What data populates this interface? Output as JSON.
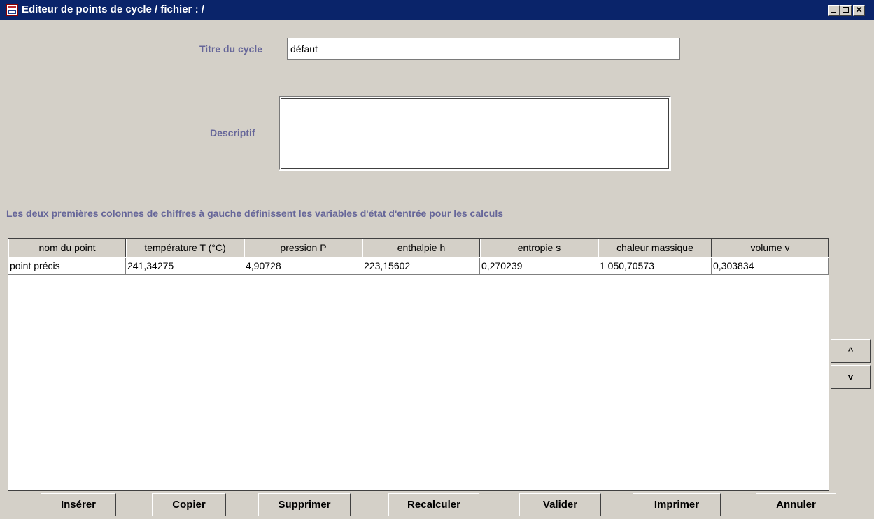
{
  "window": {
    "title": "Editeur de points de cycle / fichier :  /",
    "app_icon": "java-cup-icon"
  },
  "form": {
    "title_label": "Titre du cycle",
    "title_value": "défaut",
    "desc_label": "Descriptif",
    "desc_value": "",
    "info_text": "Les deux premières colonnes de chiffres à gauche définissent les variables d'état d'entrée pour les calculs"
  },
  "table": {
    "columns": [
      "nom du point",
      "température  T (°C)",
      "pression  P",
      "enthalpie  h",
      "entropie  s",
      "chaleur massique",
      "volume  v"
    ],
    "rows": [
      [
        "point précis",
        "241,34275",
        "4,90728",
        "223,15602",
        "0,270239",
        "1 050,70573",
        "0,303834"
      ]
    ]
  },
  "side": {
    "up": "^",
    "down": "v"
  },
  "buttons": {
    "insert": "Insérer",
    "copy": "Copier",
    "delete": "Supprimer",
    "recalc": "Recalculer",
    "validate": "Valider",
    "print": "Imprimer",
    "cancel": "Annuler"
  },
  "colors": {
    "titlebar": "#0a246a",
    "label": "#666699",
    "panel": "#d4d0c8"
  }
}
